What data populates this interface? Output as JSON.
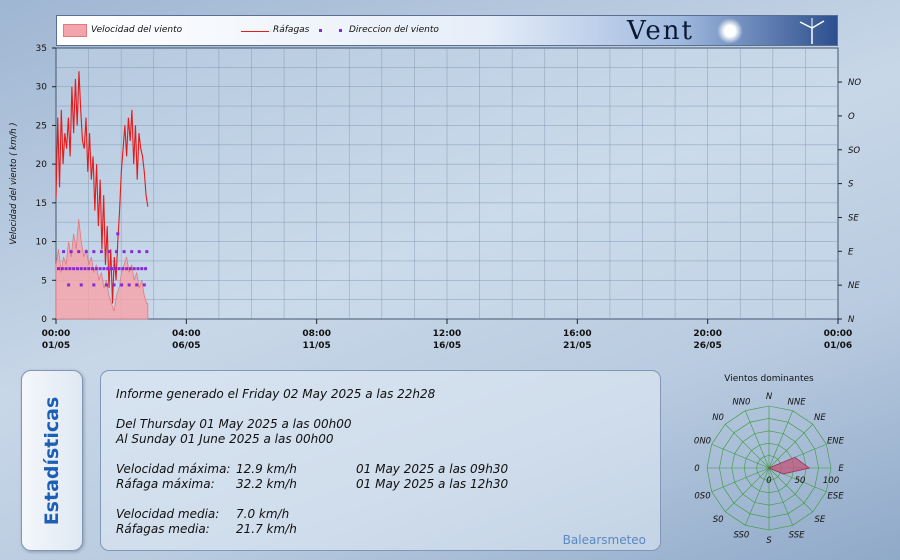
{
  "legend": {
    "wind_speed": "Velocidad del viento",
    "gusts": "Ráfagas",
    "direction": "Direccion del viento"
  },
  "app_title": "Vent",
  "colors": {
    "speed_fill": "#f4a5ab",
    "gust_line": "#e31b1b",
    "direction_dots": "#8a27d6",
    "rose_fill": "#c2567a",
    "rose_grid": "#3c9a3c"
  },
  "chart_data": [
    {
      "type": "line",
      "ylabel": "Velocidad del viento ( km/h )",
      "ylim": [
        0,
        35
      ],
      "y_ticks": [
        0,
        5,
        10,
        15,
        20,
        25,
        30,
        35
      ],
      "right_ylabels": [
        "N",
        "NE",
        "E",
        "SE",
        "S",
        "SO",
        "O",
        "NO"
      ],
      "x_tick_labels": [
        [
          "00:00",
          "01/05"
        ],
        [
          "04:00",
          "06/05"
        ],
        [
          "08:00",
          "11/05"
        ],
        [
          "12:00",
          "16/05"
        ],
        [
          "16:00",
          "21/05"
        ],
        [
          "20:00",
          "26/05"
        ],
        [
          "00:00",
          "01/06"
        ]
      ],
      "x_range_days": [
        0,
        31
      ],
      "grid": true,
      "series": [
        {
          "name": "Ráfagas",
          "x_days": [
            0.0,
            0.07,
            0.14,
            0.21,
            0.28,
            0.35,
            0.42,
            0.49,
            0.56,
            0.63,
            0.7,
            0.77,
            0.84,
            0.91,
            0.98,
            1.05,
            1.12,
            1.19,
            1.26,
            1.33,
            1.4,
            1.47,
            1.54,
            1.61,
            1.68,
            1.75,
            1.82,
            1.89,
            1.96,
            2.03,
            2.1,
            2.17,
            2.24,
            2.31,
            2.38,
            2.45,
            2.52,
            2.59,
            2.66,
            2.73,
            2.8,
            2.87,
            2.94,
            3.01,
            3.08,
            3.15,
            3.22,
            3.29,
            3.36,
            3.43,
            3.5,
            3.57,
            3.64
          ],
          "values": [
            15.5,
            26,
            17,
            27,
            20,
            24,
            22,
            26,
            21,
            30,
            24,
            31,
            25,
            32,
            27,
            23,
            22,
            26,
            19,
            24,
            18,
            21,
            14,
            20,
            12,
            18,
            9,
            16,
            7,
            12,
            4,
            9,
            2,
            8,
            5,
            10,
            14,
            19,
            22,
            25,
            21,
            26,
            23,
            27,
            20,
            25,
            18,
            24,
            22,
            21,
            19,
            16,
            14.5
          ]
        },
        {
          "name": "Velocidad del viento",
          "x_days": [
            0.0,
            0.1,
            0.2,
            0.3,
            0.4,
            0.5,
            0.6,
            0.7,
            0.8,
            0.9,
            1.0,
            1.1,
            1.2,
            1.3,
            1.4,
            1.5,
            1.6,
            1.7,
            1.8,
            1.9,
            2.0,
            2.1,
            2.2,
            2.3,
            2.4,
            2.5,
            2.6,
            2.7,
            2.8,
            2.9,
            3.0,
            3.1,
            3.2,
            3.3,
            3.4,
            3.5,
            3.6,
            3.64
          ],
          "values": [
            7,
            9,
            6,
            8,
            7,
            10,
            8,
            11,
            9,
            12.9,
            10,
            8,
            9,
            7,
            8,
            6,
            7,
            5,
            6,
            4,
            5,
            3,
            2,
            1,
            3,
            4,
            6,
            7,
            8,
            6,
            7,
            5,
            6,
            4,
            5,
            3,
            2,
            2
          ]
        },
        {
          "name": "Direccion del viento",
          "x_days": [
            0.1,
            0.25,
            0.4,
            0.55,
            0.7,
            0.85,
            1.0,
            1.15,
            1.3,
            1.45,
            1.6,
            1.75,
            1.9,
            2.05,
            2.2,
            2.35,
            2.5,
            2.65,
            2.8,
            2.95,
            3.1,
            3.25,
            3.4,
            3.55,
            0.3,
            0.6,
            0.9,
            1.2,
            1.5,
            1.8,
            2.1,
            2.4,
            2.7,
            3.0,
            3.3,
            3.6,
            0.5,
            1.0,
            1.5,
            2.0,
            2.3,
            2.6,
            2.9,
            3.2,
            3.5,
            2.45
          ],
          "values": [
            6.5,
            6.5,
            6.5,
            6.5,
            6.5,
            6.5,
            6.5,
            6.5,
            6.5,
            6.5,
            6.5,
            6.5,
            6.5,
            6.5,
            6.5,
            6.5,
            6.5,
            6.5,
            6.5,
            6.5,
            6.5,
            6.5,
            6.5,
            6.5,
            8.7,
            8.7,
            8.7,
            8.7,
            8.7,
            8.7,
            8.7,
            8.7,
            8.7,
            8.7,
            8.7,
            8.7,
            4.4,
            4.4,
            4.4,
            4.4,
            4.4,
            4.4,
            4.4,
            4.4,
            4.4,
            11
          ]
        }
      ]
    },
    {
      "type": "radar",
      "title": "Vientos dominantes",
      "directions": [
        "N",
        "NNE",
        "NE",
        "ENE",
        "E",
        "ESE",
        "SE",
        "SSE",
        "S",
        "SS0",
        "S0",
        "0S0",
        "0",
        "0N0",
        "N0",
        "NN0"
      ],
      "radial_ticks": [
        0,
        50,
        100
      ],
      "values": [
        0,
        0,
        0,
        45,
        65,
        25,
        0,
        0,
        0,
        0,
        0,
        0,
        0,
        0,
        0,
        0
      ]
    }
  ],
  "stats_tab": "Estadísticas",
  "report": {
    "generated": "Informe generado el Friday 02 May 2025 a las 22h28",
    "from": "Del Thursday 01 May 2025 a las 00h00",
    "to": "Al Sunday 01 June 2025 a las 00h00",
    "max_speed_label": "Velocidad máxima:",
    "max_speed_value": "12.9 km/h",
    "max_speed_time": "01 May 2025 a las 09h30",
    "max_gust_label": "Ráfaga máxima:",
    "max_gust_value": "32.2 km/h",
    "max_gust_time": "01 May 2025 a las 12h30",
    "avg_speed_label": "Velocidad media:",
    "avg_speed_value": "7.0 km/h",
    "avg_gust_label": "Ráfagas media:",
    "avg_gust_value": "21.7 km/h",
    "brand": "Balearsmeteo"
  }
}
